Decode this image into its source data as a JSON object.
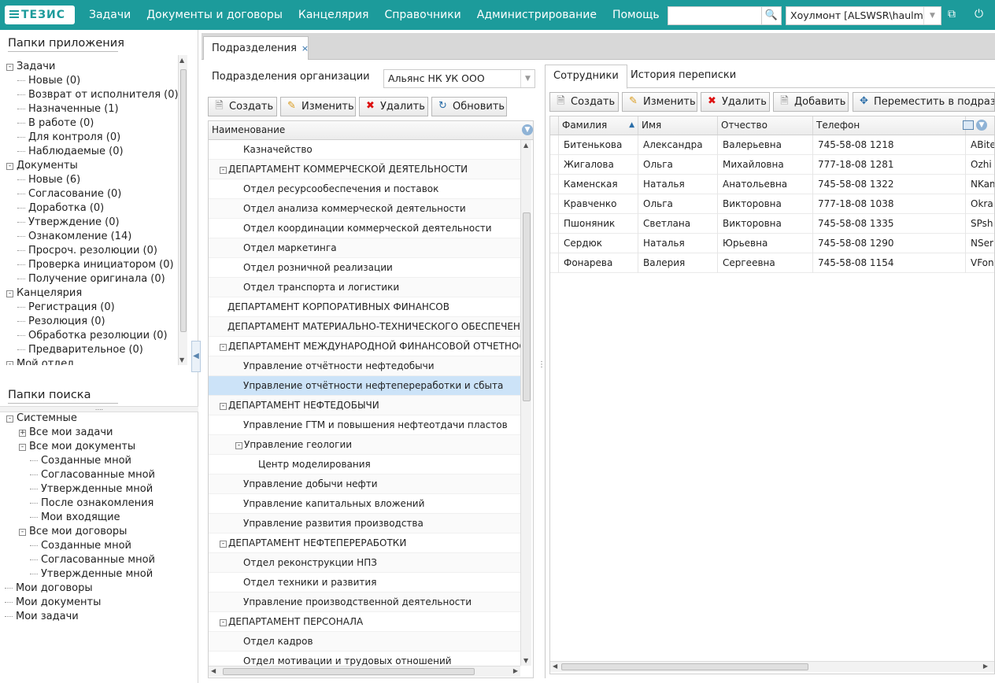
{
  "app": {
    "logo": "ТЕЗИС",
    "menu": [
      "Задачи",
      "Документы и договоры",
      "Канцелярия",
      "Справочники",
      "Администрирование",
      "Помощь"
    ],
    "search_placeholder": "",
    "user": "Хоулмонт  [ALSWSR\\haulmont"
  },
  "left": {
    "app_folders_title": "Папки приложения",
    "app_folders": [
      {
        "label": "Задачи",
        "level": 0,
        "toggle": "-"
      },
      {
        "label": "Новые (0)",
        "level": 1
      },
      {
        "label": "Возврат от исполнителя (0)",
        "level": 1
      },
      {
        "label": "Назначенные (1)",
        "level": 1
      },
      {
        "label": "В работе (0)",
        "level": 1
      },
      {
        "label": "Для контроля (0)",
        "level": 1
      },
      {
        "label": "Наблюдаемые (0)",
        "level": 1
      },
      {
        "label": "Документы",
        "level": 0,
        "toggle": "-"
      },
      {
        "label": "Новые (6)",
        "level": 1
      },
      {
        "label": "Согласование (0)",
        "level": 1
      },
      {
        "label": "Доработка (0)",
        "level": 1
      },
      {
        "label": "Утверждение (0)",
        "level": 1
      },
      {
        "label": "Ознакомление (14)",
        "level": 1
      },
      {
        "label": "Просроч. резолюции (0)",
        "level": 1
      },
      {
        "label": "Проверка инициатором (0)",
        "level": 1
      },
      {
        "label": "Получение оригинала (0)",
        "level": 1
      },
      {
        "label": "Канцелярия",
        "level": 0,
        "toggle": "-"
      },
      {
        "label": "Регистрация (0)",
        "level": 1
      },
      {
        "label": "Резолюция (0)",
        "level": 1
      },
      {
        "label": "Обработка резолюции (0)",
        "level": 1
      },
      {
        "label": "Предварительное (0)",
        "level": 1
      },
      {
        "label": "Мой отдел",
        "level": 0,
        "toggle": "-"
      }
    ],
    "search_folders_title": "Папки поиска",
    "search_folders": [
      {
        "label": "Системные",
        "level": 0,
        "toggle": "-"
      },
      {
        "label": "Все мои задачи",
        "level": 1,
        "toggle": "+"
      },
      {
        "label": "Все мои документы",
        "level": 1,
        "toggle": "-"
      },
      {
        "label": "Созданные мной",
        "level": 2
      },
      {
        "label": "Согласованные мной",
        "level": 2
      },
      {
        "label": "Утвержденные мной",
        "level": 2
      },
      {
        "label": "После ознакомления",
        "level": 2
      },
      {
        "label": "Мои входящие",
        "level": 2
      },
      {
        "label": "Все мои договоры",
        "level": 1,
        "toggle": "-"
      },
      {
        "label": "Созданные мной",
        "level": 2
      },
      {
        "label": "Согласованные мной",
        "level": 2
      },
      {
        "label": "Утвержденные мной",
        "level": 2
      },
      {
        "label": "Мои договоры",
        "level": 0
      },
      {
        "label": "Мои документы",
        "level": 0
      },
      {
        "label": "Мои задачи",
        "level": 0
      }
    ]
  },
  "main_tab": {
    "label": "Подразделения",
    "close": "×"
  },
  "org": {
    "label": "Подразделения организации",
    "value": "Альянс НК УК ООО"
  },
  "toolbar_left": [
    "Создать",
    "Изменить",
    "Удалить",
    "Обновить"
  ],
  "tree_grid": {
    "header": "Наименование",
    "rows": [
      {
        "label": "Казначейство",
        "level": 1
      },
      {
        "label": "ДЕПАРТАМЕНТ КОММЕРЧЕСКОЙ ДЕЯТЕЛЬНОСТИ",
        "level": 0,
        "toggle": "-"
      },
      {
        "label": "Отдел ресурсообеспечения и поставок",
        "level": 1
      },
      {
        "label": "Отдел анализа коммерческой деятельности",
        "level": 1
      },
      {
        "label": "Отдел координации коммерческой деятельности",
        "level": 1
      },
      {
        "label": "Отдел маркетинга",
        "level": 1
      },
      {
        "label": "Отдел розничной реализации",
        "level": 1
      },
      {
        "label": "Отдел транспорта и логистики",
        "level": 1
      },
      {
        "label": "ДЕПАРТАМЕНТ КОРПОРАТИВНЫХ ФИНАНСОВ",
        "level": 0
      },
      {
        "label": "ДЕПАРТАМЕНТ МАТЕРИАЛЬНО-ТЕХНИЧЕСКОГО ОБЕСПЕЧЕНИЯ",
        "level": 0
      },
      {
        "label": "ДЕПАРТАМЕНТ МЕЖДУНАРОДНОЙ ФИНАНСОВОЙ ОТЧЕТНОСТИ",
        "level": 0,
        "toggle": "-"
      },
      {
        "label": "Управление отчётности нефтедобычи",
        "level": 1
      },
      {
        "label": "Управление отчётности нефтепереработки и сбыта",
        "level": 1,
        "selected": true
      },
      {
        "label": "ДЕПАРТАМЕНТ НЕФТЕДОБЫЧИ",
        "level": 0,
        "toggle": "-"
      },
      {
        "label": "Управление ГТМ и повышения нефтеотдачи пластов",
        "level": 1
      },
      {
        "label": "Управление геологии",
        "level": 1,
        "toggle": "-"
      },
      {
        "label": "Центр моделирования",
        "level": 2
      },
      {
        "label": "Управление добычи нефти",
        "level": 1
      },
      {
        "label": "Управление капитальных вложений",
        "level": 1
      },
      {
        "label": "Управление развития производства",
        "level": 1
      },
      {
        "label": "ДЕПАРТАМЕНТ НЕФТЕПЕРЕРАБОТКИ",
        "level": 0,
        "toggle": "-"
      },
      {
        "label": "Отдел реконструкции НПЗ",
        "level": 1
      },
      {
        "label": "Отдел техники и развития",
        "level": 1
      },
      {
        "label": "Управление производственной деятельности",
        "level": 1
      },
      {
        "label": "ДЕПАРТАМЕНТ ПЕРСОНАЛА",
        "level": 0,
        "toggle": "-"
      },
      {
        "label": "Отдел кадров",
        "level": 1
      },
      {
        "label": "Отдел мотивации и трудовых отношений",
        "level": 1
      }
    ]
  },
  "right_tabs": [
    "Сотрудники",
    "История переписки"
  ],
  "toolbar_right": [
    "Создать",
    "Изменить",
    "Удалить",
    "Добавить",
    "Переместить в подразд"
  ],
  "employees": {
    "columns": [
      "Фамилия",
      "Имя",
      "Отчество",
      "Телефон"
    ],
    "rows": [
      [
        "Битенькова",
        "Александра",
        "Валерьевна",
        "745-58-08 1218",
        "ABite"
      ],
      [
        "Жигалова",
        "Ольга",
        "Михайловна",
        "777-18-08 1281",
        "Ozhi"
      ],
      [
        "Каменская",
        "Наталья",
        "Анатольевна",
        "745-58-08 1322",
        "NKam"
      ],
      [
        "Кравченко",
        "Ольга",
        "Викторовна",
        "777-18-08 1038",
        "Okra"
      ],
      [
        "Пшоняник",
        "Светлана",
        "Викторовна",
        "745-58-08 1335",
        "SPsh"
      ],
      [
        "Сердюк",
        "Наталья",
        "Юрьевна",
        "745-58-08 1290",
        "NSer"
      ],
      [
        "Фонарева",
        "Валерия",
        "Сергеевна",
        "745-58-08 1154",
        "VFon"
      ]
    ]
  },
  "colors": {
    "topbar": "#1c9b9b",
    "selected_row": "#cce3f8",
    "accent_icon": "#2a6da8"
  }
}
